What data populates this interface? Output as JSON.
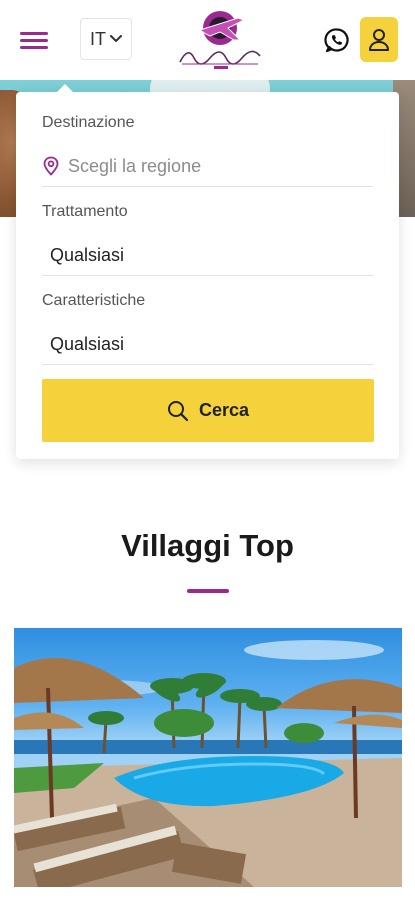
{
  "header": {
    "menu_icon": "hamburger-icon",
    "language": "IT",
    "language_icon": "chevron-down-icon",
    "logo_icon": "plane-logo-icon",
    "whatsapp_icon": "whatsapp-icon",
    "user_icon": "user-icon",
    "brand_color": "#9b2a8f",
    "accent_color": "#f5d13b"
  },
  "search": {
    "destination": {
      "label": "Destinazione",
      "placeholder": "Scegli la regione",
      "icon": "map-pin-icon"
    },
    "treatment": {
      "label": "Trattamento",
      "value": "Qualsiasi"
    },
    "features": {
      "label": "Caratteristiche",
      "value": "Qualsiasi"
    },
    "button_label": "Cerca",
    "button_icon": "search-icon"
  },
  "section": {
    "title": "Villaggi Top"
  }
}
